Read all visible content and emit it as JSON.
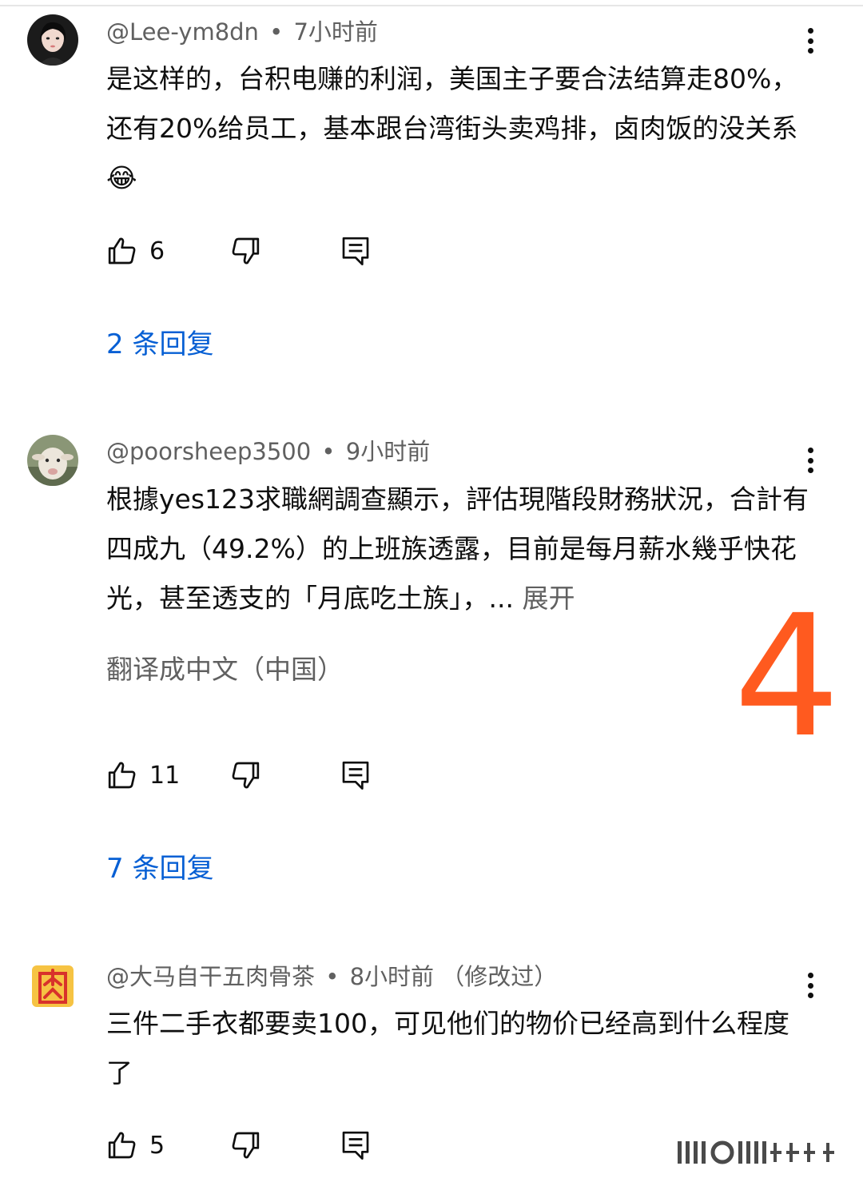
{
  "comments": [
    {
      "author": "@Lee-ym8dn",
      "separator": "•",
      "time": "7小时前",
      "edited": "",
      "text": "是这样的，台积电赚的利润，美国主子要合法结算走80%，还有20%给员工，基本跟台湾街头卖鸡排，卤肉饭的没关系😂",
      "expand": "",
      "translate": "",
      "likes": "6",
      "replies": "2 条回复",
      "avatar_icon": "portrait-avatar-icon"
    },
    {
      "author": "@poorsheep3500",
      "separator": "•",
      "time": "9小时前",
      "edited": "",
      "text": "根據yes123求職網調查顯示，評估現階段財務狀況，合計有四成九（49.2%）的上班族透露，目前是每月薪水幾乎快花光，甚至透支的「月底吃土族」，...",
      "expand": "展开",
      "translate": "翻译成中文（中国）",
      "likes": "11",
      "replies": "7 条回复",
      "avatar_icon": "sheep-avatar-icon"
    },
    {
      "author": "@大马自干五肉骨茶",
      "separator": "•",
      "time": "8小时前",
      "edited": "（修改过）",
      "text": "三件二手衣都要卖100，可见他们的物价已经高到什么程度了",
      "expand": "",
      "translate": "",
      "likes": "5",
      "replies": "",
      "avatar_icon": "meat-avatar-icon"
    }
  ],
  "overlay_number": "4",
  "colors": {
    "accent_link": "#065fd4",
    "overlay": "#ff5a1f",
    "meta": "#606060"
  }
}
